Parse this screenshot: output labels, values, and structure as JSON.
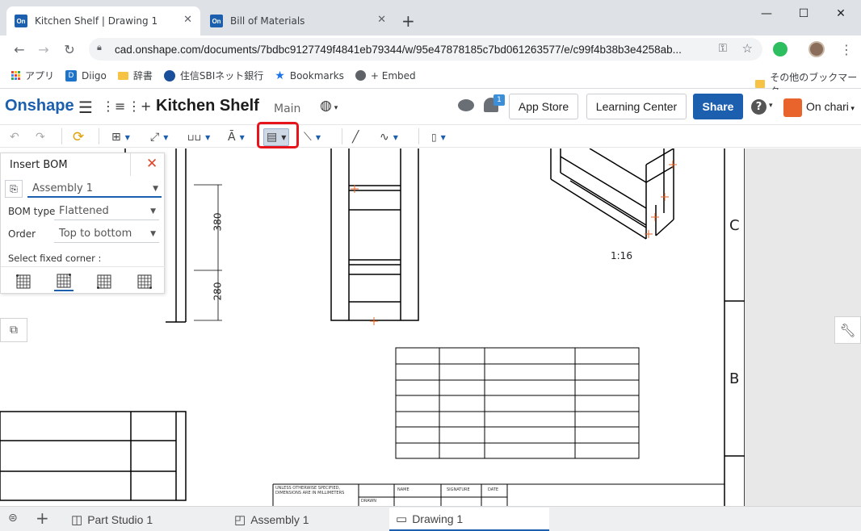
{
  "browser": {
    "tabs": [
      {
        "favicon": "On",
        "label": "Kitchen Shelf | Drawing 1",
        "active": true
      },
      {
        "favicon": "On",
        "label": "Bill of Materials",
        "active": false
      }
    ],
    "new_tab": "+",
    "window_controls": {
      "minimize": "—",
      "maximize": "☐",
      "close": "✕"
    },
    "url": "cad.onshape.com/documents/7bdbc9127749f4841eb79344/w/95e47878185c7bd061263577/e/c99f4b38b3e4258ab...",
    "bookmarks": [
      "アプリ",
      "Diigo",
      "辞書",
      "住信SBIネット銀行",
      "Bookmarks",
      "+ Embed"
    ],
    "other_bookmarks": "その他のブックマーク"
  },
  "app": {
    "logo": "Onshape",
    "document_title": "Kitchen Shelf",
    "workspace": "Main",
    "notification_count": "1",
    "app_store": "App Store",
    "learning_center": "Learning Center",
    "share": "Share",
    "help": "?",
    "user": "On chari"
  },
  "bom_panel": {
    "title": "Insert BOM",
    "assembly": "Assembly 1",
    "bom_type_label": "BOM type",
    "bom_type_value": "Flattened",
    "order_label": "Order",
    "order_value": "Top to bottom",
    "corner_label": "Select fixed corner :"
  },
  "drawing": {
    "dim_380": "380",
    "dim_280": "280",
    "scale": "1:16",
    "zone_c": "C",
    "zone_b": "B",
    "title_block": {
      "note": "UNLESS OTHERWISE SPECIFIED, DIMENSIONS ARE IN MILLIMETERS",
      "name": "NAME",
      "signature": "SIGNATURE",
      "date": "DATE",
      "drawn": "DRAWN"
    }
  },
  "bottom_tabs": [
    {
      "label": "Part Studio 1",
      "active": false
    },
    {
      "label": "Assembly 1",
      "active": false
    },
    {
      "label": "Drawing 1",
      "active": true
    }
  ],
  "colors": {
    "brand": "#1b5fae",
    "highlight": "#e8141b",
    "close": "#e0462a"
  }
}
